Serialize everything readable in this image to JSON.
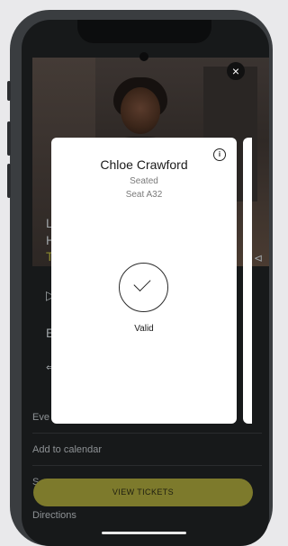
{
  "ticket": {
    "name": "Chloe Crawford",
    "status": "Seated",
    "seat": "Seat A32",
    "validity": "Valid"
  },
  "list": {
    "row1": "Eve",
    "row2": "Add to calendar",
    "row3": "S",
    "row4": "Directions"
  },
  "actions": {
    "view_tickets": "VIEW TICKETS",
    "close": "×",
    "info": "i"
  },
  "colors": {
    "accent": "#7d7a2c",
    "background": "#17191a"
  }
}
